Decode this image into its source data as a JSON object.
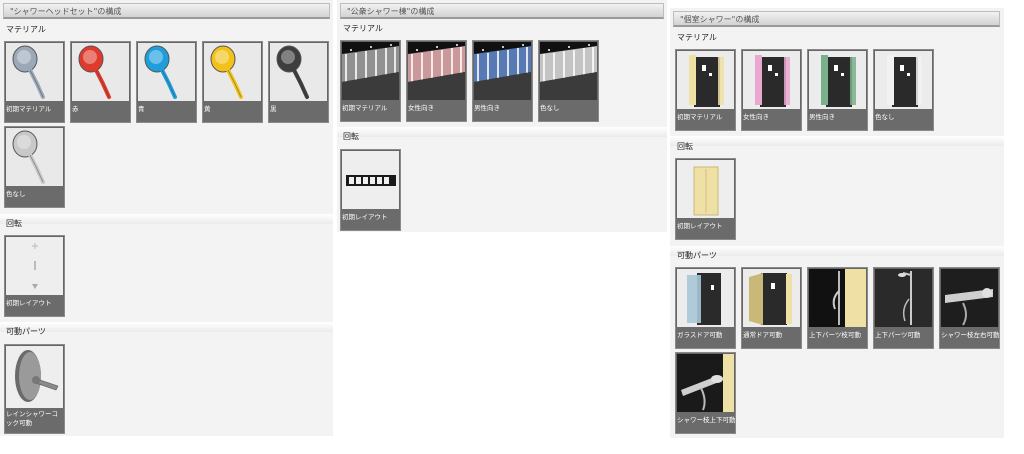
{
  "panel1": {
    "title": "\"シャワーヘッドセット\"の構成",
    "sections": {
      "material": "マテリアル",
      "rotation": "回転",
      "movable": "可動パーツ"
    },
    "material_items": [
      "初期マテリアル",
      "赤",
      "青",
      "黄",
      "黒",
      "色なし"
    ],
    "rotation_items": [
      "初期レイアウト"
    ],
    "movable_items": [
      "レインシャワーコック可動"
    ]
  },
  "panel2": {
    "title": "\"公衆シャワー棟\"の構成",
    "sections": {
      "material": "マテリアル",
      "rotation": "回転"
    },
    "material_items": [
      "初期マテリアル",
      "女性向き",
      "男性向き",
      "色なし"
    ],
    "rotation_items": [
      "初期レイアウト"
    ]
  },
  "panel3": {
    "title": "\"個室シャワー\"の構成",
    "sections": {
      "material": "マテリアル",
      "rotation": "回転",
      "movable": "可動パーツ"
    },
    "material_items": [
      "初期マテリアル",
      "女性向き",
      "男性向き",
      "色なし"
    ],
    "rotation_items": [
      "初期レイアウト"
    ],
    "movable_items": [
      "ガラスドア可動",
      "通常ドア可動",
      "上下パーツ枝可動",
      "上下パーツ可動",
      "シャワー枝左右可動",
      "シャワー枝上下可動"
    ]
  },
  "colors": {
    "shower_default": "#9aa8b8",
    "shower_red": "#e03a2c",
    "shower_blue": "#1e9fdc",
    "shower_yellow": "#f2c21a",
    "shower_black": "#3e3e3e",
    "shower_none": "#c8c8c8",
    "female_accent": "#e0a8a8",
    "male_accent": "#5f86c8",
    "booth_yellow": "#efe0a6",
    "glass_blue": "#a8c8d8"
  }
}
